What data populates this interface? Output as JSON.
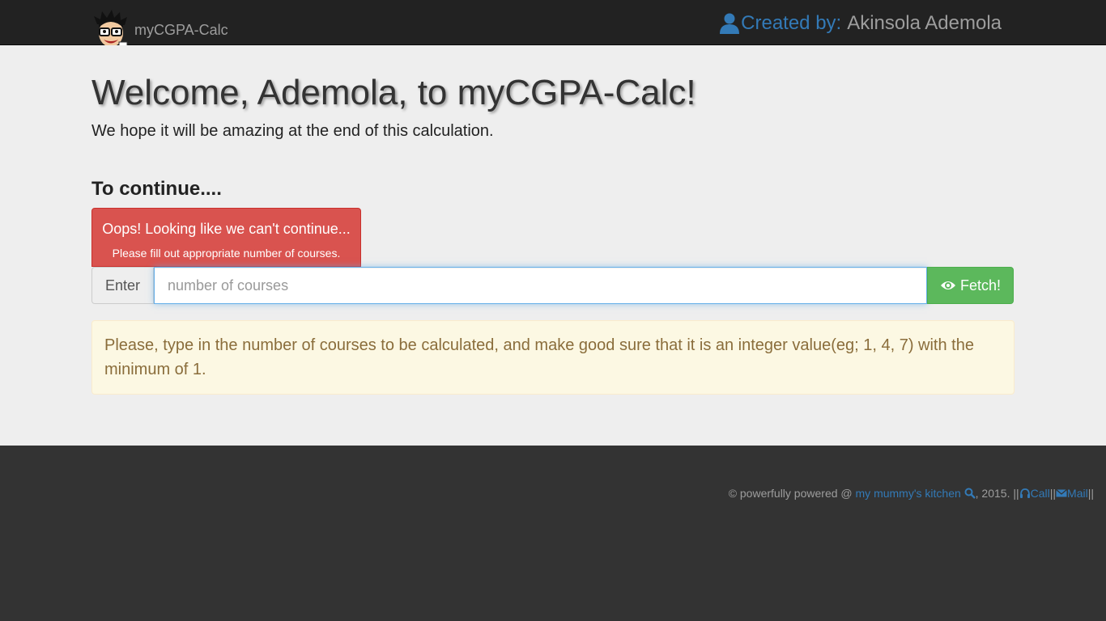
{
  "navbar": {
    "brand": "myCGPA-Calc",
    "created_label": "Created by:",
    "created_name": "Akinsola Ademola"
  },
  "main": {
    "welcome": "Welcome, Ademola, to myCGPA-Calc!",
    "subtitle": "We hope it will be amazing at the end of this calculation.",
    "continue": "To continue....",
    "error_title": "Oops! Looking like we can't continue...",
    "error_msg": "Please fill out appropriate number of courses.",
    "input_addon": "Enter",
    "input_placeholder": "number of courses",
    "input_value": "",
    "fetch_label": "Fetch!",
    "warning": "Please, type in the number of courses to be calculated, and make good sure that it is an integer value(eg; 1, 4, 7) with the minimum of 1."
  },
  "footer": {
    "prefix": "© powerfully powered @ ",
    "link": "my mummy's kitchen",
    "year": ", 2015. || ",
    "call": "Call",
    "sep": " || ",
    "mail": "Mail",
    "end": " ||"
  },
  "colors": {
    "navbar": "#222222",
    "main_bg": "#eeeeee",
    "footer_bg": "#333333",
    "danger": "#d9534f",
    "success": "#5cb85c",
    "link": "#337ab7",
    "warning_text": "#8a6d3b"
  },
  "icons": {
    "brand": "cartoon-avatar-icon",
    "created": "user-icon",
    "fetch": "eye-icon",
    "search": "search-icon",
    "call": "headphones-icon",
    "mail": "envelope-icon"
  }
}
